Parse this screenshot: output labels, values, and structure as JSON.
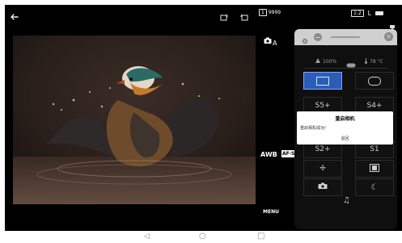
{
  "status": {
    "back_icon": "arrow-left",
    "storage_badge": "1",
    "shots_remaining": "9999",
    "quality_badge": "1:2",
    "size_letter": "L",
    "battery_icon": "battery",
    "connection_icon": "usb-plug"
  },
  "right_controls": {
    "mode_label": "A",
    "awb_label": "AWB",
    "af_label": "AF-S",
    "menu_label": "MENU"
  },
  "panel": {
    "title_icons": [
      "gear",
      "minus"
    ],
    "close_label": "×",
    "wifi_percent": "100%",
    "temperature": "78 °C",
    "tiles": [
      {
        "label": "",
        "icon": "square-frame",
        "selected": true
      },
      {
        "label": "",
        "icon": "rounded-frame",
        "selected": false
      },
      {
        "label": "S5+",
        "icon": "",
        "selected": false
      },
      {
        "label": "S4+",
        "icon": "",
        "selected": false
      },
      {
        "label": "S2+",
        "icon": "",
        "selected": false
      },
      {
        "label": "S1",
        "icon": "",
        "selected": false
      },
      {
        "label": "",
        "icon": "fan",
        "selected": false
      },
      {
        "label": "",
        "icon": "film",
        "selected": false
      },
      {
        "label": "",
        "icon": "camera",
        "selected": false
      },
      {
        "label": "",
        "icon": "moon",
        "selected": false
      }
    ],
    "bottom_icon": "music-note"
  },
  "dialog": {
    "title": "重启相机",
    "message": "重启相机成功!",
    "button": "退回"
  },
  "nav": {
    "back": "◁",
    "home": "○",
    "recent": "□"
  },
  "colors": {
    "panel_bg": "#0f0f0f",
    "selected_tile": "#2a5db8",
    "dialog_bg": "#ffffff"
  }
}
